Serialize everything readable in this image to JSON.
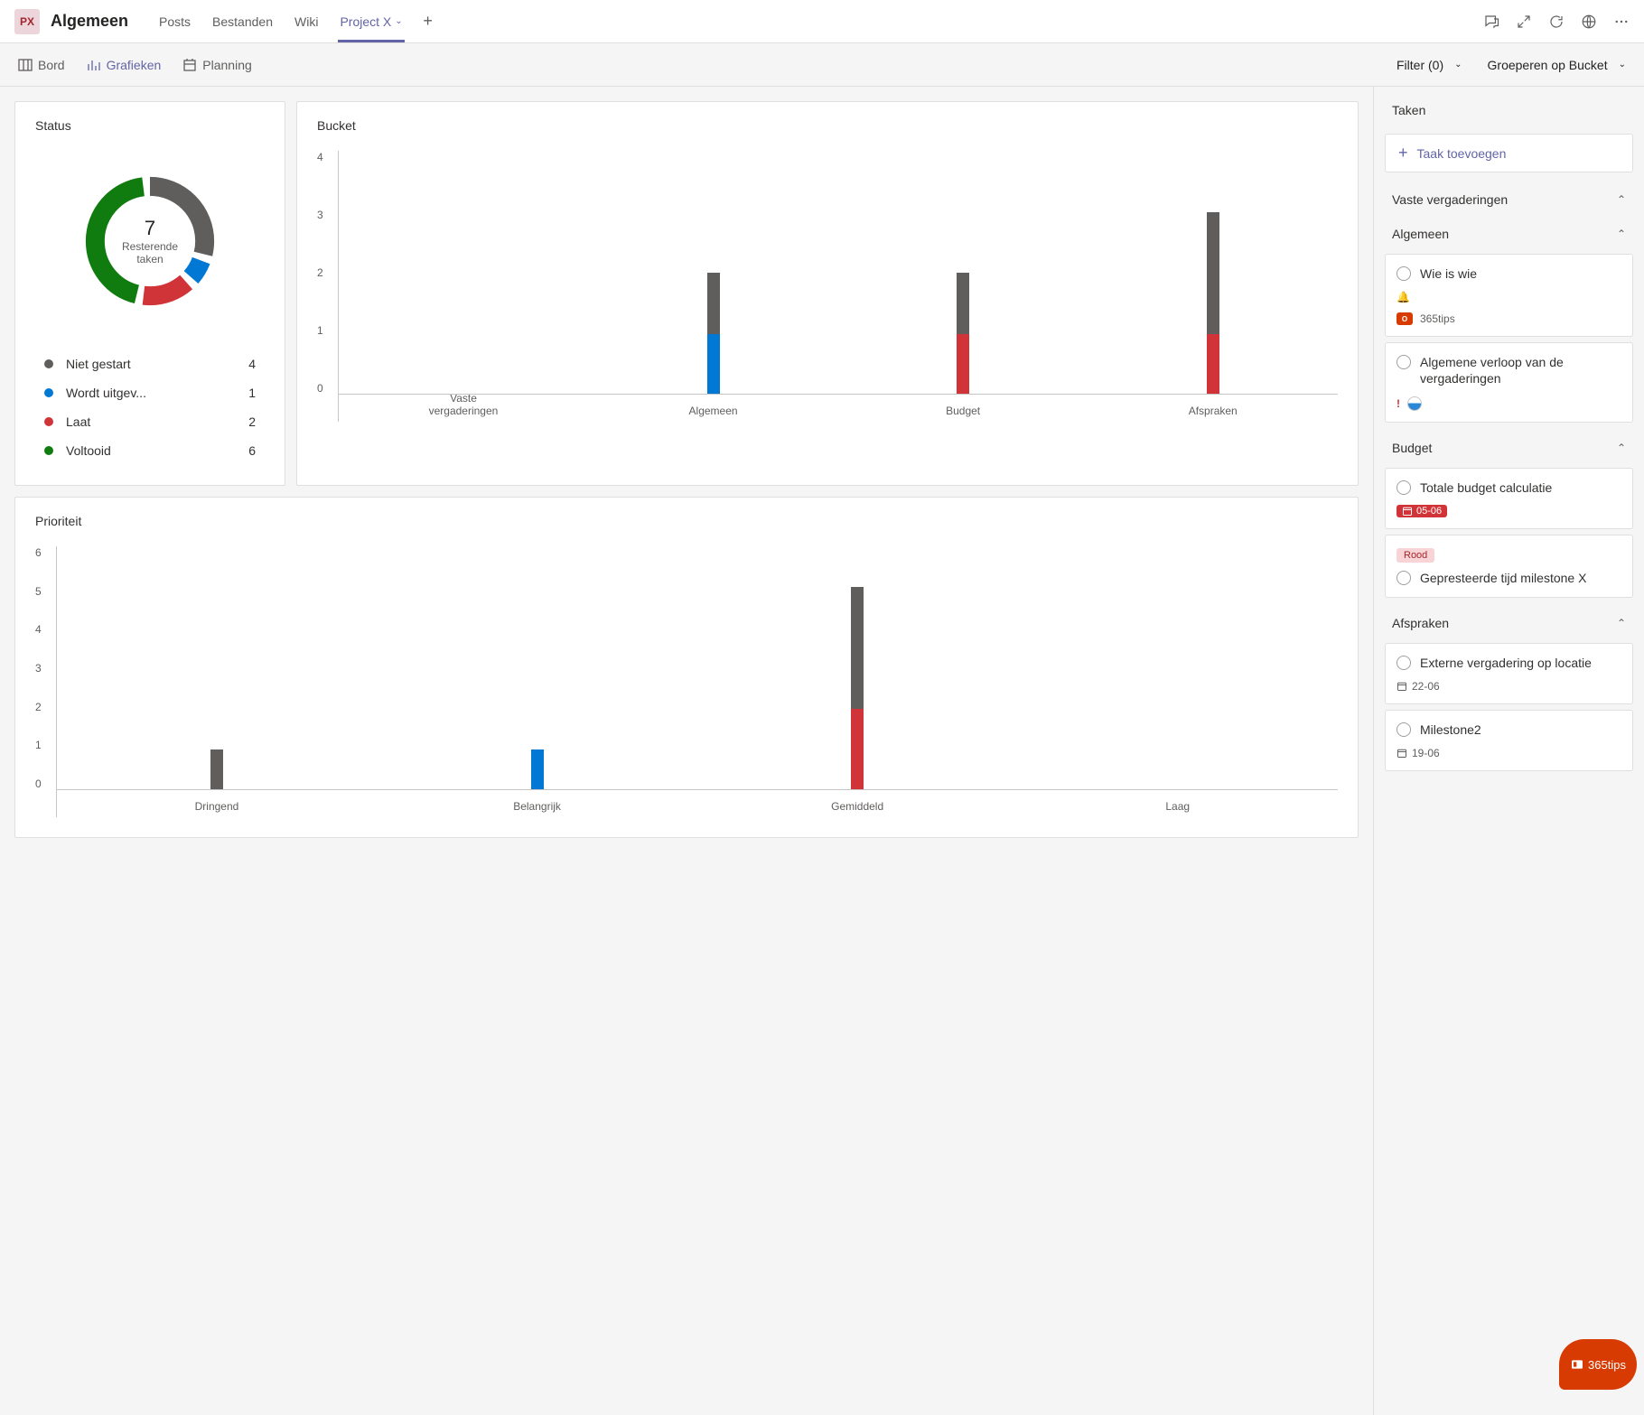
{
  "colors": {
    "niet_gestart": "#605e5c",
    "wordt_uitgev": "#0078d4",
    "laat": "#d13438",
    "voltooid": "#107c10",
    "accent": "#6264a7"
  },
  "topbar": {
    "team_initials": "PX",
    "channel_name": "Algemeen",
    "tabs": [
      "Posts",
      "Bestanden",
      "Wiki",
      "Project X"
    ],
    "active_tab_index": 3
  },
  "subnav": {
    "items": [
      "Bord",
      "Grafieken",
      "Planning"
    ],
    "active_index": 1,
    "filter_label": "Filter (0)",
    "group_label": "Groeperen op Bucket"
  },
  "cards": {
    "status_title": "Status",
    "bucket_title": "Bucket",
    "priority_title": "Prioriteit"
  },
  "donut": {
    "center_number": "7",
    "center_label": "Resterende taken",
    "legend": [
      {
        "label": "Niet gestart",
        "value": 4,
        "color": "#605e5c"
      },
      {
        "label": "Wordt uitgev...",
        "value": 1,
        "color": "#0078d4"
      },
      {
        "label": "Laat",
        "value": 2,
        "color": "#d13438"
      },
      {
        "label": "Voltooid",
        "value": 6,
        "color": "#107c10"
      }
    ],
    "total": 13
  },
  "sidebar": {
    "title": "Taken",
    "add_task": "Taak toevoegen",
    "sections": [
      {
        "title": "Vaste vergaderingen",
        "tasks": []
      },
      {
        "title": "Algemeen",
        "tasks": [
          {
            "title": "Wie is wie",
            "icons": [
              "bell"
            ],
            "brand": "365tips"
          },
          {
            "title": "Algemene verloop van de vergaderingen",
            "icons": [
              "excl",
              "avatar"
            ]
          }
        ]
      },
      {
        "title": "Budget",
        "tasks": [
          {
            "title": "Totale budget calculatie",
            "date_chip": "05-06"
          },
          {
            "pill": "Rood",
            "title": "Gepresteerde tijd milestone X"
          }
        ]
      },
      {
        "title": "Afspraken",
        "tasks": [
          {
            "title": "Externe vergadering op locatie",
            "date_plain": "22-06"
          },
          {
            "title": "Milestone2",
            "date_plain": "19-06"
          }
        ]
      }
    ]
  },
  "chart_data": [
    {
      "type": "pie",
      "title": "Status",
      "series": [
        {
          "name": "Niet gestart",
          "value": 4,
          "color": "#605e5c"
        },
        {
          "name": "Wordt uitgev...",
          "value": 1,
          "color": "#0078d4"
        },
        {
          "name": "Laat",
          "value": 2,
          "color": "#d13438"
        },
        {
          "name": "Voltooid",
          "value": 6,
          "color": "#107c10"
        }
      ],
      "center_value": 7,
      "center_label": "Resterende taken"
    },
    {
      "type": "bar",
      "title": "Bucket",
      "categories": [
        "Vaste vergaderingen",
        "Algemeen",
        "Budget",
        "Afspraken"
      ],
      "y_ticks": [
        0,
        1,
        2,
        3,
        4
      ],
      "ylim": [
        0,
        4
      ],
      "stack_colors": {
        "bottom": "#0078d4",
        "bottom_alt": "#d13438",
        "top": "#605e5c"
      },
      "stacks": [
        {
          "category": "Vaste vergaderingen",
          "segments": []
        },
        {
          "category": "Algemeen",
          "segments": [
            {
              "series": "Wordt uitgev",
              "value": 1,
              "color": "#0078d4"
            },
            {
              "series": "Niet gestart",
              "value": 1,
              "color": "#605e5c"
            }
          ]
        },
        {
          "category": "Budget",
          "segments": [
            {
              "series": "Laat",
              "value": 1,
              "color": "#d13438"
            },
            {
              "series": "Niet gestart",
              "value": 1,
              "color": "#605e5c"
            }
          ]
        },
        {
          "category": "Afspraken",
          "segments": [
            {
              "series": "Laat",
              "value": 1,
              "color": "#d13438"
            },
            {
              "series": "Niet gestart",
              "value": 2,
              "color": "#605e5c"
            }
          ]
        }
      ]
    },
    {
      "type": "bar",
      "title": "Prioriteit",
      "categories": [
        "Dringend",
        "Belangrijk",
        "Gemiddeld",
        "Laag"
      ],
      "y_ticks": [
        0,
        1,
        2,
        3,
        4,
        5,
        6
      ],
      "ylim": [
        0,
        6
      ],
      "stacks": [
        {
          "category": "Dringend",
          "segments": [
            {
              "series": "Niet gestart",
              "value": 1,
              "color": "#605e5c"
            }
          ]
        },
        {
          "category": "Belangrijk",
          "segments": [
            {
              "series": "Wordt uitgev",
              "value": 1,
              "color": "#0078d4"
            }
          ]
        },
        {
          "category": "Gemiddeld",
          "segments": [
            {
              "series": "Laat",
              "value": 2,
              "color": "#d13438"
            },
            {
              "series": "Niet gestart",
              "value": 3,
              "color": "#605e5c"
            }
          ]
        },
        {
          "category": "Laag",
          "segments": []
        }
      ]
    }
  ],
  "brand_float": "365tips"
}
